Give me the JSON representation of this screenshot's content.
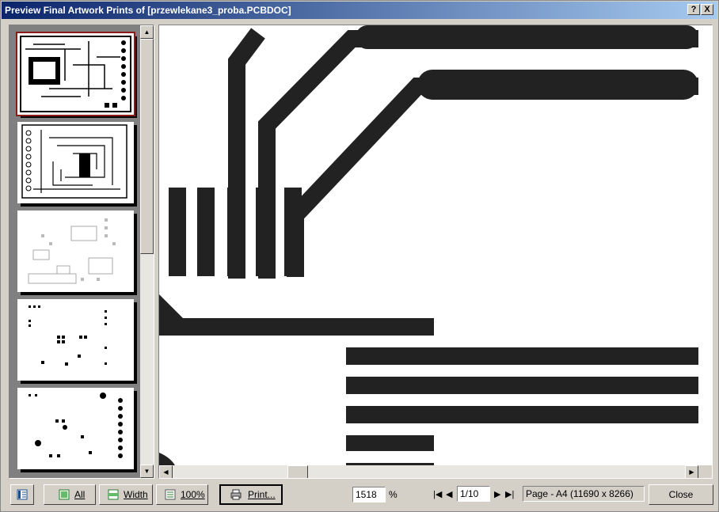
{
  "window": {
    "title": "Preview Final Artwork Prints of [przewlekane3_proba.PCBDOC]",
    "help_button": "?",
    "close_button": "X"
  },
  "thumbnails": {
    "count": 5,
    "selected_index": 0
  },
  "toolbar": {
    "all_label": "All",
    "width_label": "Width",
    "zoom100_label": "100%",
    "print_label": "Print...",
    "zoom_value": "1518",
    "zoom_unit": "%",
    "page_value": "1/10",
    "page_info": "Page - A4 (11690 x 8266)",
    "close_label": "Close"
  },
  "icons": {
    "thumbs_toggle": "thumbnail-panel-icon",
    "all": "fit-all-icon",
    "width": "fit-width-icon",
    "zoom100": "zoom-100-icon",
    "print": "printer-icon",
    "first": "first-page-icon",
    "prev": "prev-page-icon",
    "next": "next-page-icon",
    "last": "last-page-icon"
  },
  "colors": {
    "title_start": "#0a246a",
    "title_end": "#a6caf0",
    "selection": "#8b1a1a",
    "trace": "#222222"
  }
}
